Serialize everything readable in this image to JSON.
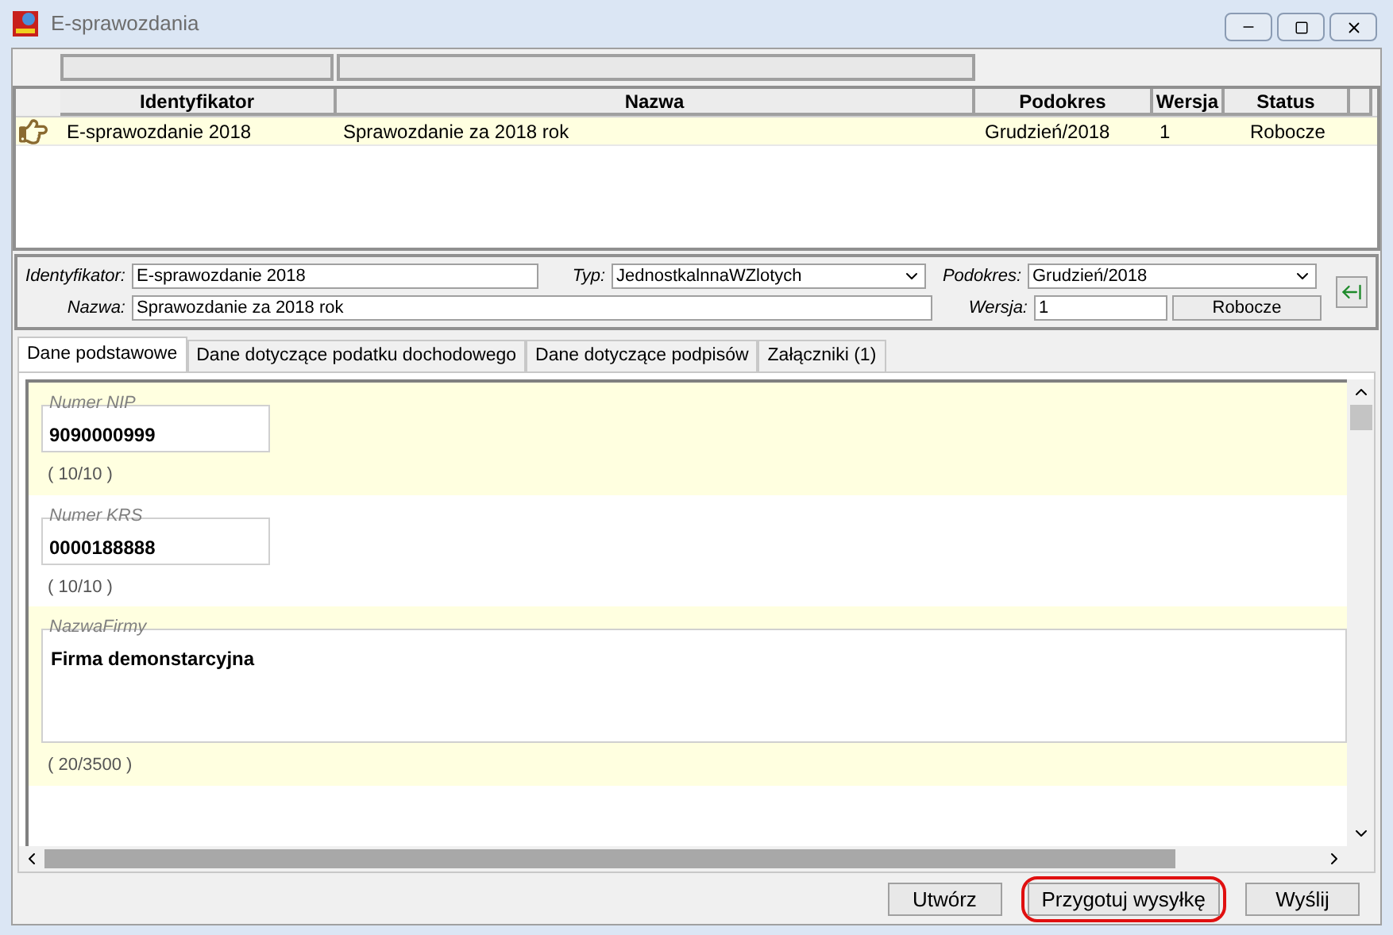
{
  "window": {
    "title": "E-sprawozdania"
  },
  "table": {
    "columns": [
      "Identyfikator",
      "Nazwa",
      "Podokres",
      "Wersja",
      "Status"
    ],
    "rows": [
      {
        "cells": [
          "E-sprawozdanie 2018",
          "Sprawozdanie za 2018 rok",
          "Grudzień/2018",
          "1",
          "Robocze"
        ],
        "selected": true
      }
    ]
  },
  "form": {
    "identyfikator": {
      "label": "Identyfikator:",
      "value": "E-sprawozdanie 2018"
    },
    "typ": {
      "label": "Typ:",
      "value": "JednostkalnnaWZlotych"
    },
    "podokres": {
      "label": "Podokres:",
      "value": "Grudzień/2018"
    },
    "nazwa": {
      "label": "Nazwa:",
      "value": "Sprawozdanie za 2018 rok"
    },
    "wersja": {
      "label": "Wersja:",
      "value": "1"
    },
    "status": "Robocze"
  },
  "tabs": [
    {
      "label": "Dane podstawowe",
      "selected": true
    },
    {
      "label": "Dane dotyczące podatku dochodowego",
      "selected": false
    },
    {
      "label": "Dane dotyczące podpisów",
      "selected": false
    },
    {
      "label": "Załączniki (1)",
      "selected": false
    }
  ],
  "sections": [
    {
      "kind": "field",
      "label": "Numer NIP",
      "value": "9090000999",
      "counter": "( 10/10 )",
      "shaded": true
    },
    {
      "kind": "field",
      "label": "Numer KRS",
      "value": "0000188888",
      "counter": "( 10/10 )",
      "shaded": false
    },
    {
      "kind": "textarea",
      "label": "NazwaFirmy",
      "value": "Firma demonstarcyjna",
      "counter": "( 20/3500 )",
      "shaded": true
    }
  ],
  "buttons": [
    {
      "label": "Utwórz",
      "highlighted": false
    },
    {
      "label": "Przygotuj wysyłkę",
      "highlighted": true
    },
    {
      "label": "Wyślij",
      "highlighted": false
    }
  ]
}
